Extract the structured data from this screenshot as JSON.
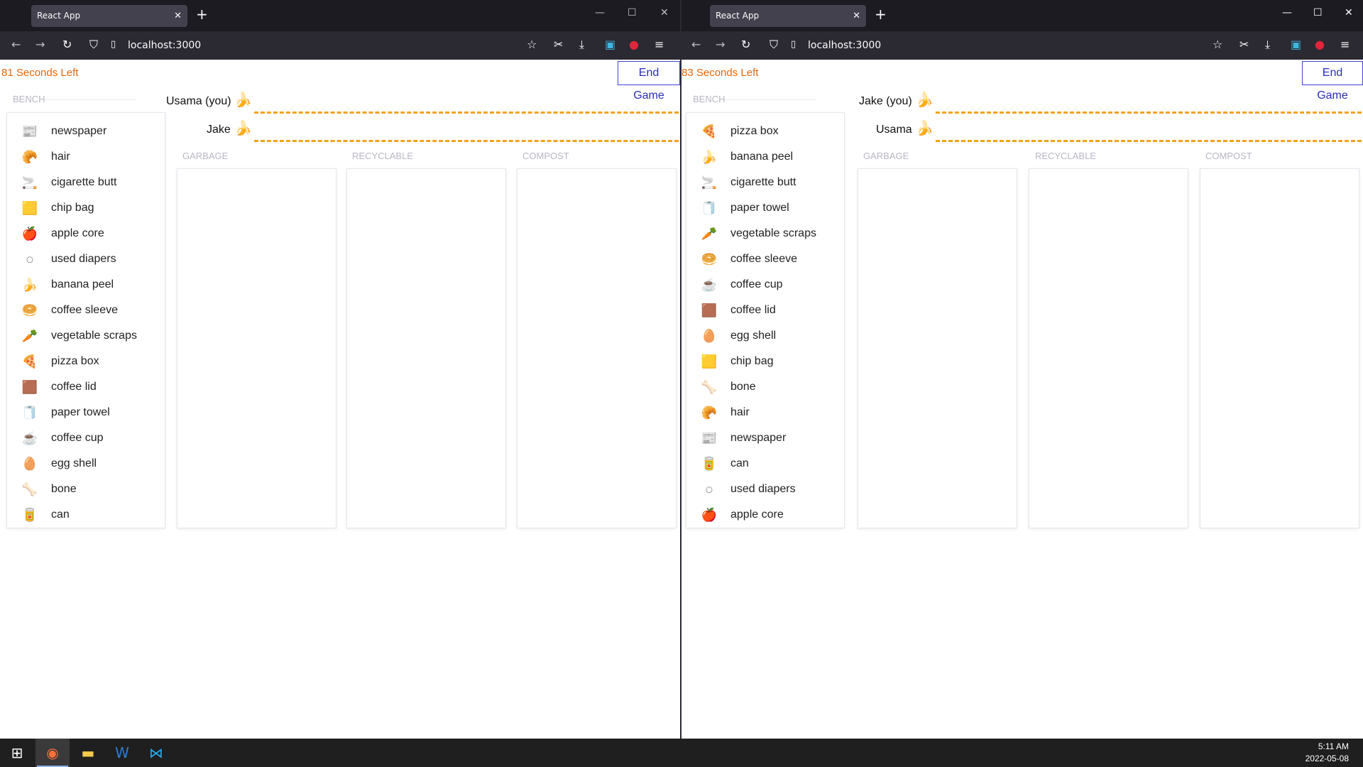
{
  "windows": [
    {
      "tab_title": "React App",
      "url": "localhost:3000",
      "timer": "81 Seconds Left",
      "end_game_label": "End Game",
      "bench_label": "BENCH",
      "players": [
        {
          "name": "Usama (you)"
        },
        {
          "name": "Jake"
        }
      ],
      "bins": [
        "GARBAGE",
        "RECYCLABLE",
        "COMPOST"
      ],
      "items": [
        {
          "label": "newspaper",
          "icon": "newspaper-icon"
        },
        {
          "label": "hair",
          "icon": "hair-icon"
        },
        {
          "label": "cigarette butt",
          "icon": "cigarette-icon"
        },
        {
          "label": "chip bag",
          "icon": "chip-bag-icon"
        },
        {
          "label": "apple core",
          "icon": "apple-core-icon"
        },
        {
          "label": "used diapers",
          "icon": "diaper-icon"
        },
        {
          "label": "banana peel",
          "icon": "banana-icon"
        },
        {
          "label": "coffee sleeve",
          "icon": "coffee-sleeve-icon"
        },
        {
          "label": "vegetable scraps",
          "icon": "vegetable-icon"
        },
        {
          "label": "pizza box",
          "icon": "pizza-box-icon"
        },
        {
          "label": "coffee lid",
          "icon": "coffee-lid-icon"
        },
        {
          "label": "paper towel",
          "icon": "paper-towel-icon"
        },
        {
          "label": "coffee cup",
          "icon": "coffee-cup-icon"
        },
        {
          "label": "egg shell",
          "icon": "egg-shell-icon"
        },
        {
          "label": "bone",
          "icon": "bone-icon"
        },
        {
          "label": "can",
          "icon": "can-icon"
        }
      ]
    },
    {
      "tab_title": "React App",
      "url": "localhost:3000",
      "timer": "83 Seconds Left",
      "end_game_label": "End Game",
      "bench_label": "BENCH",
      "players": [
        {
          "name": "Jake (you)"
        },
        {
          "name": "Usama"
        }
      ],
      "bins": [
        "GARBAGE",
        "RECYCLABLE",
        "COMPOST"
      ],
      "items": [
        {
          "label": "pizza box",
          "icon": "pizza-box-icon"
        },
        {
          "label": "banana peel",
          "icon": "banana-icon"
        },
        {
          "label": "cigarette butt",
          "icon": "cigarette-icon"
        },
        {
          "label": "paper towel",
          "icon": "paper-towel-icon"
        },
        {
          "label": "vegetable scraps",
          "icon": "vegetable-icon"
        },
        {
          "label": "coffee sleeve",
          "icon": "coffee-sleeve-icon"
        },
        {
          "label": "coffee cup",
          "icon": "coffee-cup-icon"
        },
        {
          "label": "coffee lid",
          "icon": "coffee-lid-icon"
        },
        {
          "label": "egg shell",
          "icon": "egg-shell-icon"
        },
        {
          "label": "chip bag",
          "icon": "chip-bag-icon"
        },
        {
          "label": "bone",
          "icon": "bone-icon"
        },
        {
          "label": "hair",
          "icon": "hair-icon"
        },
        {
          "label": "newspaper",
          "icon": "newspaper-icon"
        },
        {
          "label": "can",
          "icon": "can-icon"
        },
        {
          "label": "used diapers",
          "icon": "diaper-icon"
        },
        {
          "label": "apple core",
          "icon": "apple-core-icon"
        }
      ]
    }
  ],
  "taskbar": {
    "time": "5:11 AM",
    "date": "2022-05-08",
    "apps": [
      "start-icon",
      "firefox-icon",
      "file-explorer-icon",
      "word-icon",
      "vscode-icon"
    ]
  },
  "colors": {
    "timer": "#e2670d",
    "end_game_border": "#3e42d9",
    "track": "#f3a21b"
  }
}
